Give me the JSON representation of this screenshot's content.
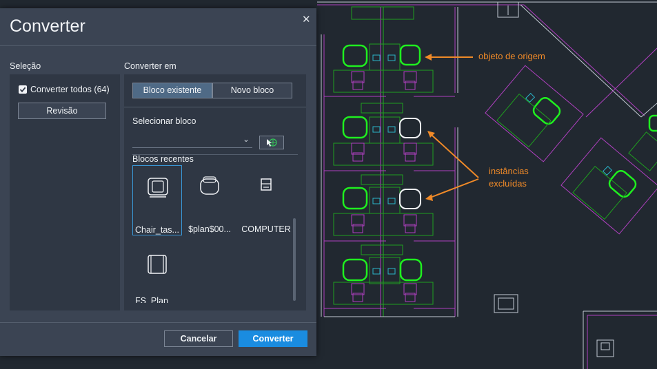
{
  "dialog": {
    "title": "Converter",
    "close_icon": "close-icon",
    "left_section_label": "Seleção",
    "convert_all_label": "Converter todos (64)",
    "convert_all_checked": true,
    "review_button": "Revisão",
    "right_section_label": "Converter em",
    "tabs": [
      "Bloco existente",
      "Novo bloco"
    ],
    "active_tab": "Bloco existente",
    "select_block_label": "Selecionar bloco",
    "select_block_value": "",
    "recent_blocks_label": "Blocos recentes",
    "recent_blocks": [
      {
        "name": "Chair_tas...",
        "icon": "office-chair-icon",
        "selected": true
      },
      {
        "name": "$plan$00...",
        "icon": "round-chair-icon",
        "selected": false
      },
      {
        "name": "COMPUTER",
        "icon": "computer-icon",
        "selected": false
      },
      {
        "name": "FS_Plan",
        "icon": "armchair-icon",
        "selected": false
      }
    ],
    "cancel_button": "Cancelar",
    "convert_button": "Converter"
  },
  "annotations": {
    "source_object": "objeto de origem",
    "excluded_instances_line1": "instâncias",
    "excluded_instances_line2": "excluídas"
  },
  "colors": {
    "dialog_bg": "#3b4453",
    "panel_bg": "#2f3744",
    "primary": "#1a8ce0",
    "canvas_bg": "#212830",
    "highlight_green": "#1ff01f",
    "annotation_orange": "#f08a28"
  }
}
